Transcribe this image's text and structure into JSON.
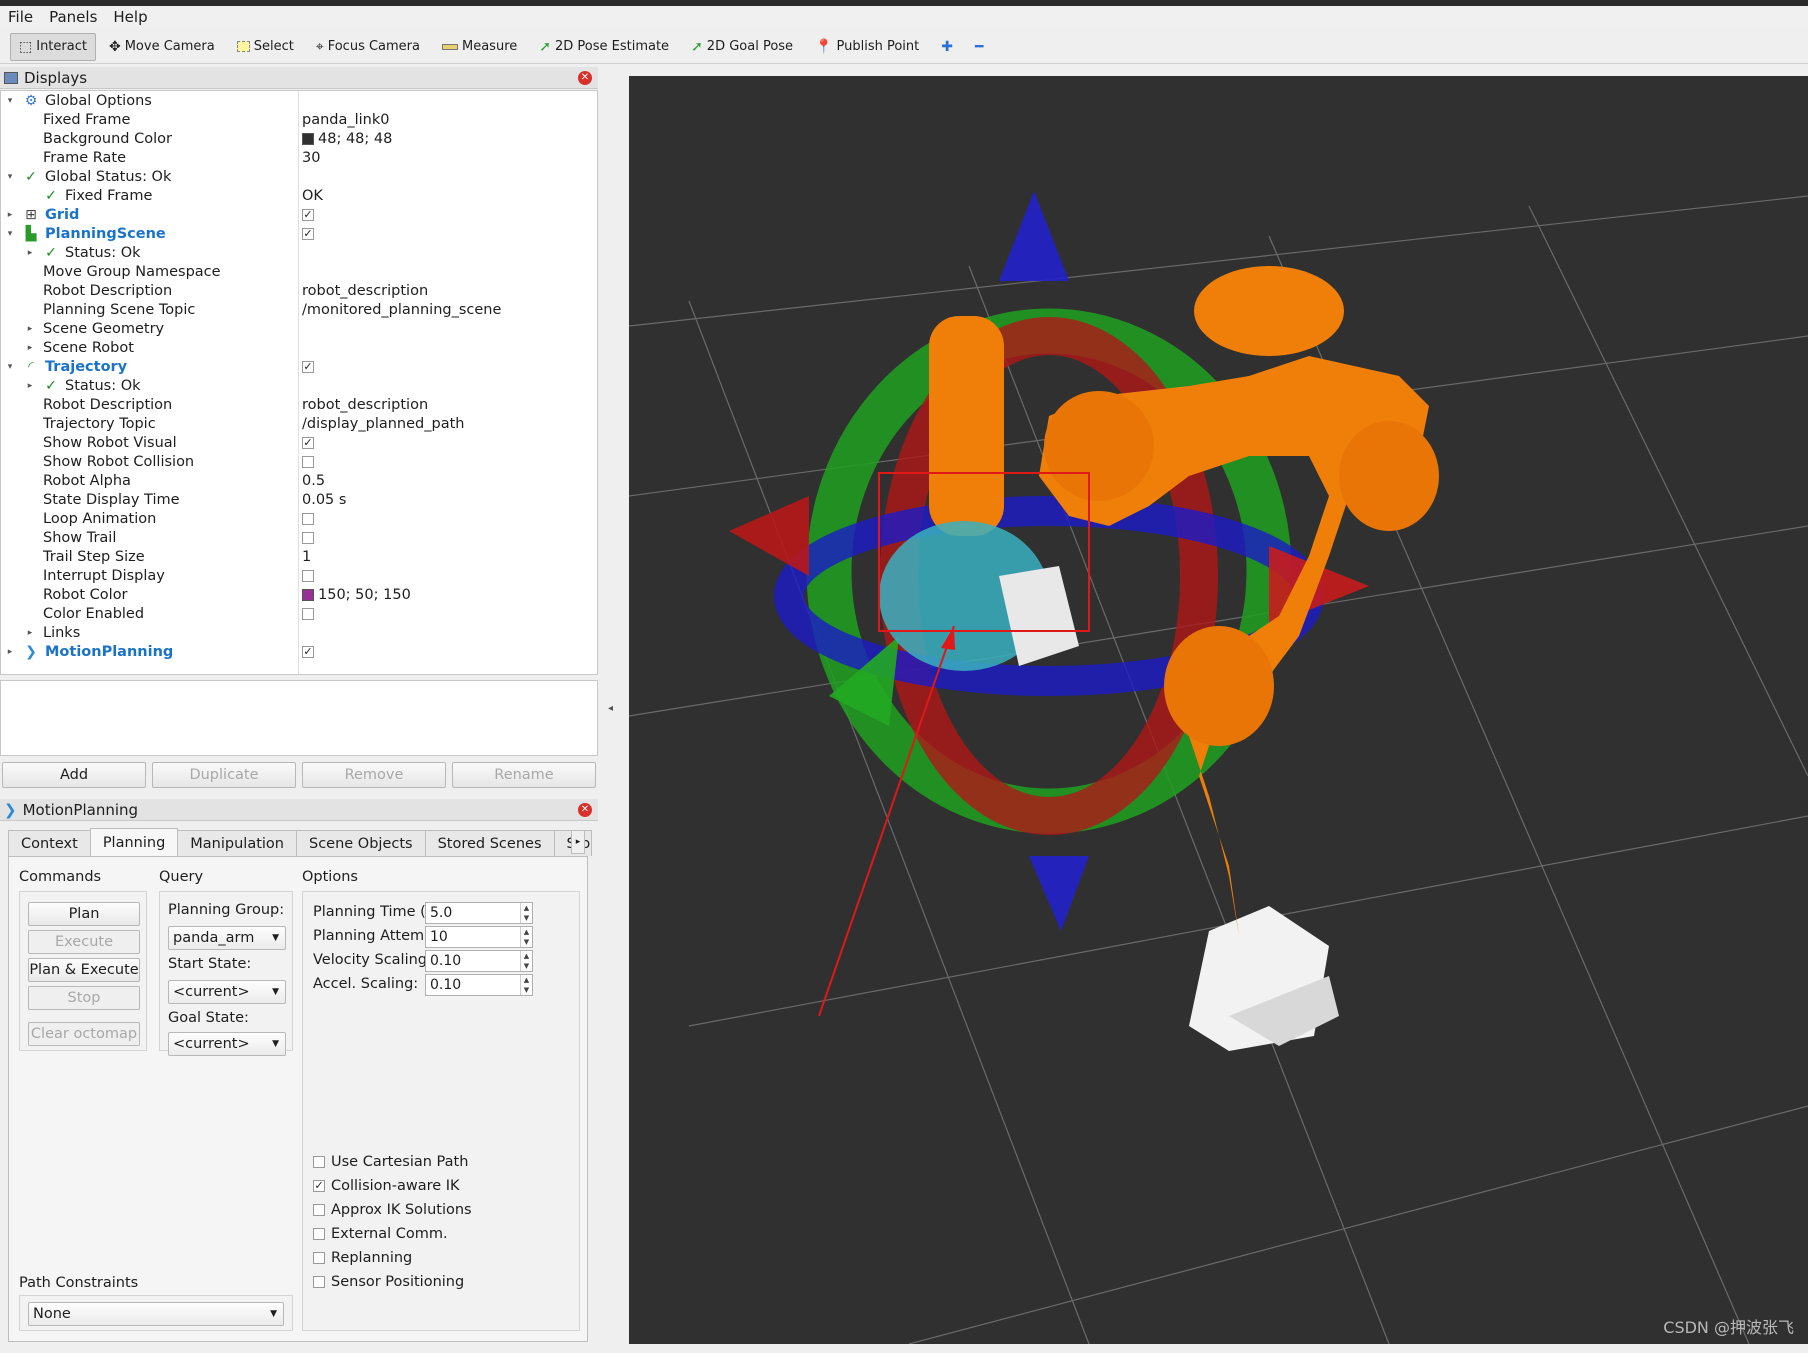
{
  "menu": [
    "File",
    "Panels",
    "Help"
  ],
  "toolbar": {
    "interact": "Interact",
    "move_camera": "Move Camera",
    "select": "Select",
    "focus_camera": "Focus Camera",
    "measure": "Measure",
    "pose_estimate": "2D Pose Estimate",
    "goal_pose": "2D Goal Pose",
    "publish_point": "Publish Point"
  },
  "displays": {
    "title": "Displays",
    "rows": [
      {
        "label": "Global Options",
        "value": ""
      },
      {
        "label": "Fixed Frame",
        "value": "panda_link0"
      },
      {
        "label": "Background Color",
        "value": "48; 48; 48",
        "swatch": "#303030"
      },
      {
        "label": "Frame Rate",
        "value": "30"
      },
      {
        "label": "Global Status: Ok",
        "value": ""
      },
      {
        "label": "Fixed Frame",
        "value": "OK"
      },
      {
        "label": "Grid",
        "value": ""
      },
      {
        "label": "PlanningScene",
        "value": ""
      },
      {
        "label": "Status: Ok",
        "value": ""
      },
      {
        "label": "Move Group Namespace",
        "value": ""
      },
      {
        "label": "Robot Description",
        "value": "robot_description"
      },
      {
        "label": "Planning Scene Topic",
        "value": "/monitored_planning_scene"
      },
      {
        "label": "Scene Geometry",
        "value": ""
      },
      {
        "label": "Scene Robot",
        "value": ""
      },
      {
        "label": "Trajectory",
        "value": ""
      },
      {
        "label": "Status: Ok",
        "value": ""
      },
      {
        "label": "Robot Description",
        "value": "robot_description"
      },
      {
        "label": "Trajectory Topic",
        "value": "/display_planned_path"
      },
      {
        "label": "Show Robot Visual",
        "value": ""
      },
      {
        "label": "Show Robot Collision",
        "value": ""
      },
      {
        "label": "Robot Alpha",
        "value": "0.5"
      },
      {
        "label": "State Display Time",
        "value": "0.05 s"
      },
      {
        "label": "Loop Animation",
        "value": ""
      },
      {
        "label": "Show Trail",
        "value": ""
      },
      {
        "label": "Trail Step Size",
        "value": "1"
      },
      {
        "label": "Interrupt Display",
        "value": ""
      },
      {
        "label": "Robot Color",
        "value": "150; 50; 150",
        "swatch": "#963296"
      },
      {
        "label": "Color Enabled",
        "value": ""
      },
      {
        "label": "Links",
        "value": ""
      },
      {
        "label": "MotionPlanning",
        "value": ""
      }
    ],
    "buttons": {
      "add": "Add",
      "duplicate": "Duplicate",
      "remove": "Remove",
      "rename": "Rename"
    }
  },
  "motion_planning": {
    "title": "MotionPlanning",
    "tabs": [
      "Context",
      "Planning",
      "Manipulation",
      "Scene Objects",
      "Stored Scenes",
      "Sto"
    ],
    "commands": {
      "header": "Commands",
      "plan": "Plan",
      "execute": "Execute",
      "plan_execute": "Plan & Execute",
      "stop": "Stop",
      "clear_octomap": "Clear octomap"
    },
    "query": {
      "header": "Query",
      "planning_group_label": "Planning Group:",
      "planning_group": "panda_arm",
      "start_state_label": "Start State:",
      "start_state": "<current>",
      "goal_state_label": "Goal State:",
      "goal_state": "<current>"
    },
    "options": {
      "header": "Options",
      "planning_time_label": "Planning Time (s):",
      "planning_time": "5.0",
      "planning_attempts_label": "Planning Attempts:",
      "planning_attempts": "10",
      "velocity_label": "Velocity Scaling:",
      "velocity": "0.10",
      "accel_label": "Accel. Scaling:",
      "accel": "0.10",
      "checkboxes": [
        {
          "label": "Use Cartesian Path",
          "checked": false
        },
        {
          "label": "Collision-aware IK",
          "checked": true
        },
        {
          "label": "Approx IK Solutions",
          "checked": false
        },
        {
          "label": "External Comm.",
          "checked": false
        },
        {
          "label": "Replanning",
          "checked": false
        },
        {
          "label": "Sensor Positioning",
          "checked": false
        }
      ]
    },
    "path_constraints": {
      "label": "Path Constraints",
      "value": "None"
    }
  },
  "viewport": {
    "background": "#303030",
    "robot_color": "#f07f0a",
    "watermark": "CSDN @押波张飞"
  }
}
